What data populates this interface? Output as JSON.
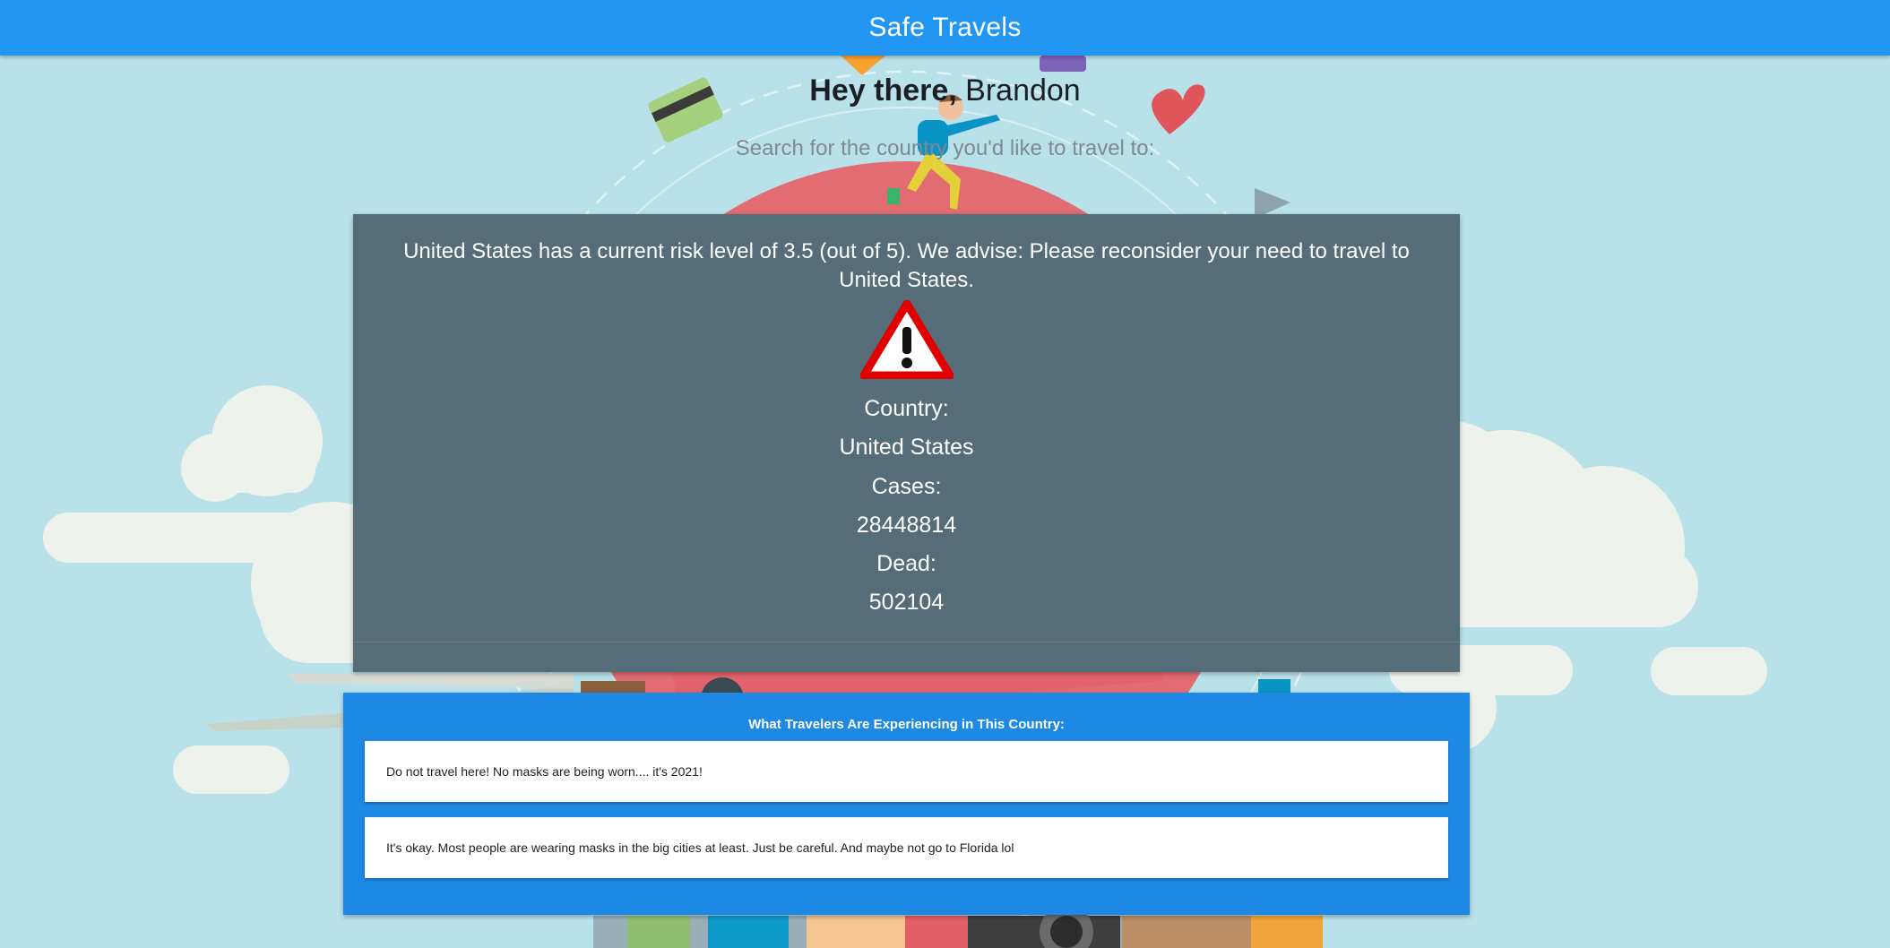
{
  "navbar": {
    "brand": "Safe Travels"
  },
  "greeting": {
    "prefix": "Hey there,",
    "name": "Brandon"
  },
  "search": {
    "prompt": "Search for the country you'd like to travel to:"
  },
  "risk_card": {
    "message": "United States has a current risk level of 3.5 (out of 5). We advise: Please reconsider your need to travel to United States.",
    "icon": "warning-icon",
    "country_label": "Country:",
    "country_value": "United States",
    "cases_label": "Cases:",
    "cases_value": "28448814",
    "dead_label": "Dead:",
    "dead_value": "502104"
  },
  "experiences": {
    "title": "What Travelers Are Experiencing in This Country:",
    "items": [
      {
        "text": "Do not travel here! No masks are being worn.... it's 2021!"
      },
      {
        "text": "It's okay. Most people are wearing masks in the big cities at least. Just be careful. And maybe not go to Florida lol"
      }
    ]
  },
  "colors": {
    "navbar": "#2196f3",
    "card": "#556d78",
    "experiences_panel": "#1e88e5",
    "background": "#b9e1ea",
    "warning_red": "#e10000"
  }
}
